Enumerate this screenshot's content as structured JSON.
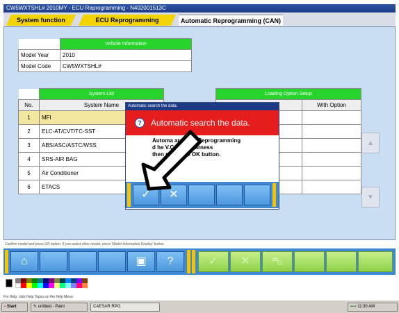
{
  "window": {
    "title": "CW5WXTSHL# 2010MY  -  ECU Reprogramming  -  N402001513C"
  },
  "tabs": [
    {
      "label": "System function"
    },
    {
      "label": "ECU Reprogramming"
    },
    {
      "label": "Automatic Reprogramming (CAN)"
    }
  ],
  "vehicle_info": {
    "heading": "Vehicle Information",
    "rows": [
      {
        "label": "Model Year",
        "value": "2010"
      },
      {
        "label": "Model Code",
        "value": "CW5WXTSHL#"
      }
    ]
  },
  "system_list": {
    "heading": "System List",
    "col_no": "No.",
    "col_name": "System Name",
    "rows": [
      {
        "no": "1",
        "name": "MFI"
      },
      {
        "no": "2",
        "name": "ELC-AT/CVT/TC-SST"
      },
      {
        "no": "3",
        "name": "ABS/ASC/ASTC/WSS"
      },
      {
        "no": "4",
        "name": "SRS-AIR BAG"
      },
      {
        "no": "5",
        "name": "Air Conditioner"
      },
      {
        "no": "6",
        "name": "ETACS"
      }
    ]
  },
  "loading_option": {
    "heading": "Loading Option Setup",
    "col_partial": "me",
    "col_with": "With Option"
  },
  "status_text": "Confirm model and press OK button. If you select other model, press 'Model Information Display' button.",
  "dialog": {
    "title": "Automatic search the data.",
    "heading": "Automatic search the data.",
    "body_line1": "Automa      arch the Reprogramming",
    "body_line2": "d            he V.C.I. and harness",
    "body_line3": "             then press the OK button."
  },
  "help_hint": "For Help, click Help Topics on the Help Menu.",
  "taskbar": {
    "start": "Start",
    "task1": "untitled - Paint",
    "task2": "CAESAR RPG",
    "clock": "11:30 AM"
  },
  "icons": {
    "home": "home-icon",
    "print": "printer-icon",
    "help": "help-icon",
    "ok": "check-icon",
    "cancel": "cross-icon",
    "car": "car-icon"
  },
  "colors": {
    "header_green": "#27d42b",
    "dialog_red": "#e61d1d",
    "toolbar_blue": "#3d89d3",
    "tab_yellow": "#f3d400",
    "selected_row": "#f3e7a0"
  }
}
